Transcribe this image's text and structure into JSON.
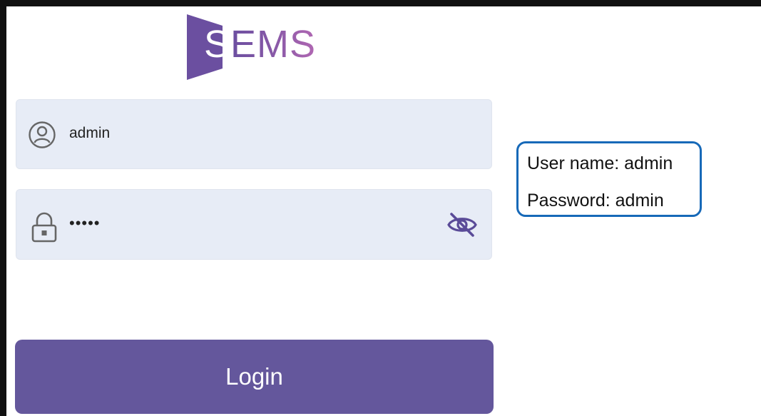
{
  "logo": {
    "first_letter": "S",
    "rest": "EMS",
    "brand_color": "#6b4fa0"
  },
  "username_field": {
    "icon": "user-circle-icon",
    "value": "admin"
  },
  "password_field": {
    "icon": "lock-icon",
    "value": "•••••",
    "toggle_icon": "eye-off-icon"
  },
  "login_button": {
    "label": "Login",
    "color": "#64579c"
  },
  "credentials_note": {
    "username_line": "User name: admin",
    "password_line": "Password: admin",
    "border_color": "#1769b8"
  }
}
